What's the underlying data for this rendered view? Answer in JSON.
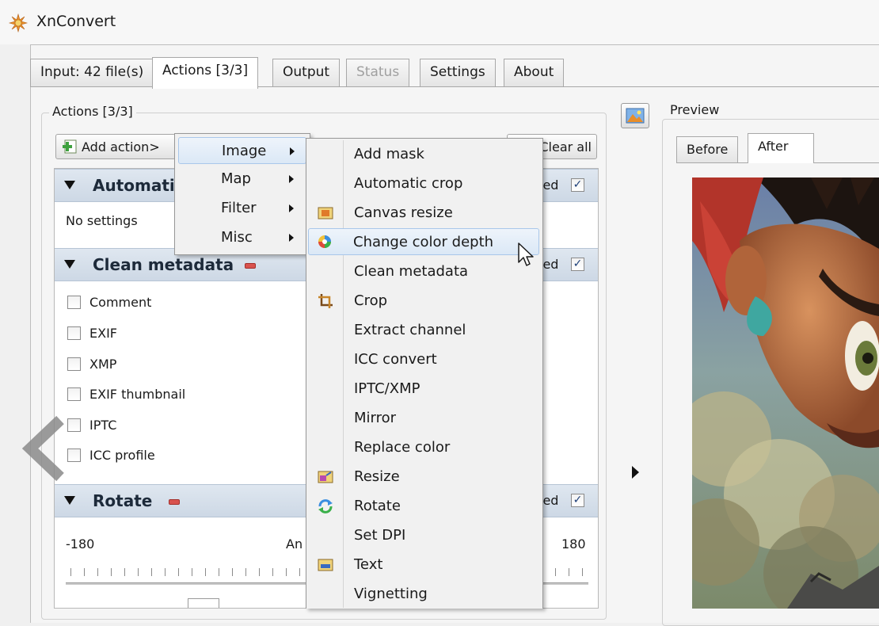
{
  "window": {
    "title": "XnConvert"
  },
  "tabs": [
    {
      "label": "Input: 42 file(s)",
      "state": "normal"
    },
    {
      "label": "Actions [3/3]",
      "state": "active"
    },
    {
      "label": "Output",
      "state": "normal"
    },
    {
      "label": "Status",
      "state": "disabled"
    },
    {
      "label": "Settings",
      "state": "normal"
    },
    {
      "label": "About",
      "state": "normal"
    }
  ],
  "actions_group": {
    "title": "Actions [3/3]",
    "add_action_label": "Add action>",
    "clear_all_label": "Clear all"
  },
  "sections": {
    "automatic": {
      "title": "Automati",
      "enabled_label": "led",
      "enabled": true,
      "body_text": "No settings"
    },
    "clean_metadata": {
      "title": "Clean metadata",
      "enabled_label": "led",
      "enabled": true,
      "options": [
        {
          "label": "Comment",
          "checked": false
        },
        {
          "label": "EXIF",
          "checked": false
        },
        {
          "label": "XMP",
          "checked": false
        },
        {
          "label": "EXIF thumbnail",
          "checked": false
        },
        {
          "label": "IPTC",
          "checked": false
        },
        {
          "label": "ICC profile",
          "checked": false
        }
      ]
    },
    "rotate": {
      "title": "Rotate",
      "enabled_label": "led",
      "enabled": true,
      "min_label": "-180",
      "max_label": "180",
      "angle_label": "An"
    }
  },
  "category_menu": {
    "items": [
      {
        "label": "Image",
        "highlighted": true
      },
      {
        "label": "Map",
        "highlighted": false
      },
      {
        "label": "Filter",
        "highlighted": false
      },
      {
        "label": "Misc",
        "highlighted": false
      }
    ]
  },
  "image_submenu": {
    "items": [
      {
        "label": "Add mask",
        "icon": ""
      },
      {
        "label": "Automatic crop",
        "icon": ""
      },
      {
        "label": "Canvas resize",
        "icon": "canvas-resize-icon"
      },
      {
        "label": "Change color depth",
        "icon": "color-depth-icon",
        "highlighted": true
      },
      {
        "label": "Clean metadata",
        "icon": ""
      },
      {
        "label": "Crop",
        "icon": "crop-icon"
      },
      {
        "label": "Extract channel",
        "icon": ""
      },
      {
        "label": "ICC convert",
        "icon": ""
      },
      {
        "label": "IPTC/XMP",
        "icon": ""
      },
      {
        "label": "Mirror",
        "icon": ""
      },
      {
        "label": "Replace color",
        "icon": ""
      },
      {
        "label": "Resize",
        "icon": "resize-icon"
      },
      {
        "label": "Rotate",
        "icon": "rotate-icon"
      },
      {
        "label": "Set DPI",
        "icon": ""
      },
      {
        "label": "Text",
        "icon": "text-icon"
      },
      {
        "label": "Vignetting",
        "icon": ""
      }
    ]
  },
  "preview": {
    "title": "Preview",
    "tabs": [
      {
        "label": "Before",
        "active": false
      },
      {
        "label": "After",
        "active": true
      }
    ]
  },
  "colors": {
    "accent_highlight": "#dbe8f6",
    "section_header": "#cdd8e5",
    "remove_red": "#d9534f"
  }
}
